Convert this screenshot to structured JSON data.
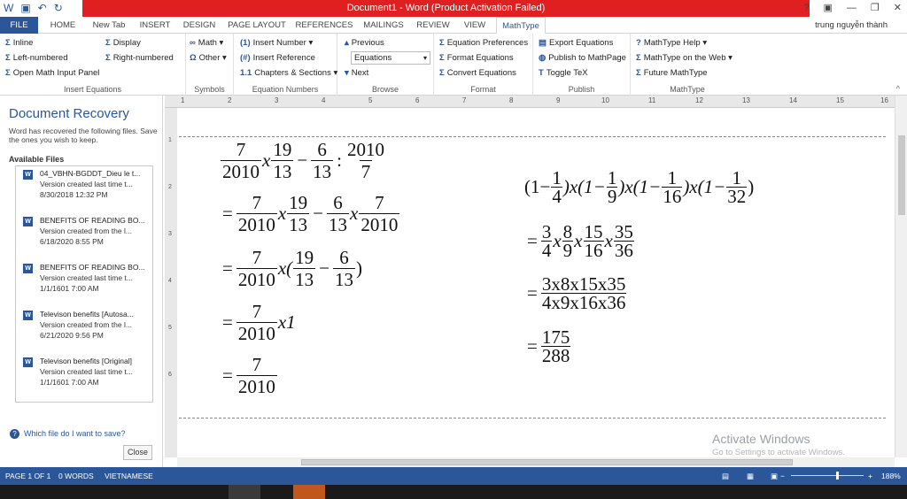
{
  "title": {
    "window_title": "Document1 - Word (Product Activation Failed)",
    "qat_icons": [
      "word-icon",
      "save-icon",
      "undo-icon",
      "redo-icon"
    ],
    "controls": [
      "?",
      "▣",
      "—",
      "❐",
      "✕"
    ]
  },
  "tabs": [
    "FILE",
    "HOME",
    "New Tab",
    "INSERT",
    "DESIGN",
    "PAGE LAYOUT",
    "REFERENCES",
    "MAILINGS",
    "REVIEW",
    "VIEW",
    "MathType"
  ],
  "user": "trung nguyễn thành",
  "ribbon": {
    "insert_equations": {
      "items": [
        "Inline",
        "Display",
        "Left-numbered",
        "Right-numbered",
        "Open Math Input Panel"
      ],
      "label": "Insert Equations"
    },
    "symbols": {
      "items": [
        "Math",
        "Other"
      ],
      "label": "Symbols"
    },
    "equation_numbers": {
      "items": [
        "Insert Number",
        "Insert Reference",
        "Chapters & Sections"
      ],
      "label": "Equation Numbers"
    },
    "browse": {
      "items": [
        "Previous",
        "Next"
      ],
      "select_value": "Equations",
      "label": "Browse"
    },
    "format": {
      "items": [
        "Equation Preferences",
        "Format Equations",
        "Convert Equations"
      ],
      "label": "Format"
    },
    "publish": {
      "items": [
        "Export Equations",
        "Publish to MathPage",
        "Toggle TeX"
      ],
      "label": "Publish"
    },
    "mathtype": {
      "items": [
        "MathType Help",
        "MathType on the Web",
        "Future MathType"
      ],
      "label": "MathType"
    }
  },
  "recovery": {
    "title": "Document Recovery",
    "subtitle": "Word has recovered the following files. Save the ones you wish to keep.",
    "files_label": "Available Files",
    "files": [
      {
        "name": "04_VBHN-BGDDT_Dieu le t...",
        "version": "Version created last time t...",
        "date": "8/30/2018 12:32 PM"
      },
      {
        "name": "BENEFITS OF READING BO...",
        "version": "Version created from the l...",
        "date": "6/18/2020 8:55 PM"
      },
      {
        "name": "BENEFITS OF READING BO...",
        "version": "Version created last time t...",
        "date": "1/1/1601 7:00 AM"
      },
      {
        "name": "Televison benefits  [Autosa...",
        "version": "Version created from the l...",
        "date": "6/21/2020 9:56 PM"
      },
      {
        "name": "Televison benefits  [Original]",
        "version": "Version created last time t...",
        "date": "1/1/1601 7:00 AM"
      }
    ],
    "help": "Which file do I want to save?",
    "close": "Close"
  },
  "ruler_numbers": [
    "1",
    "2",
    "3",
    "4",
    "5",
    "6",
    "7",
    "8",
    "9",
    "10",
    "11",
    "12",
    "13",
    "14",
    "15",
    "16"
  ],
  "left_ruler_numbers": [
    "1",
    "2",
    "3",
    "4",
    "5",
    "6"
  ],
  "math_left": {
    "l1": {
      "a_n": "7",
      "a_d": "2010",
      "x": "x",
      "b_n": "19",
      "b_d": "13",
      "minus": "−",
      "c_n": "6",
      "c_d": "13",
      "colon": ":",
      "e_n": "2010",
      "e_d": "7"
    },
    "l2": {
      "eq": "=",
      "a_n": "7",
      "a_d": "2010",
      "x": "x",
      "b_n": "19",
      "b_d": "13",
      "minus": "−",
      "c_n": "6",
      "c_d": "13",
      "x2": "x",
      "e_n": "7",
      "e_d": "2010"
    },
    "l3": {
      "eq": "=",
      "a_n": "7",
      "a_d": "2010",
      "x": "x(",
      "b_n": "19",
      "b_d": "13",
      "minus": "−",
      "c_n": "6",
      "c_d": "13",
      "close": ")"
    },
    "l4": {
      "eq": "=",
      "a_n": "7",
      "a_d": "2010",
      "tail": "x1"
    },
    "l5": {
      "eq": "=",
      "a_n": "7",
      "a_d": "2010"
    }
  },
  "math_right": {
    "r1": {
      "p1": "(1−",
      "f1n": "1",
      "f1d": "4",
      "p2": ")x(1−",
      "f2n": "1",
      "f2d": "9",
      "p3": ")x(1−",
      "f3n": "1",
      "f3d": "16",
      "p4": ")x(1−",
      "f4n": "1",
      "f4d": "32",
      "p5": ")"
    },
    "r2": {
      "eq": "=",
      "f1n": "3",
      "f1d": "4",
      "x1": "x",
      "f2n": "8",
      "f2d": "9",
      "x2": "x",
      "f3n": "15",
      "f3d": "16",
      "x3": "x",
      "f4n": "35",
      "f4d": "36"
    },
    "r3": {
      "eq": "=",
      "n": "3x8x15x35",
      "d": "4x9x16x36"
    },
    "r4": {
      "eq": "=",
      "n": "175",
      "d": "288"
    }
  },
  "watermark": {
    "line1": "Activate Windows",
    "line2": "Go to Settings to activate Windows."
  },
  "status": {
    "page": "PAGE 1 OF 1",
    "words": "0 WORDS",
    "lang": "VIETNAMESE",
    "zoom": "188%"
  }
}
